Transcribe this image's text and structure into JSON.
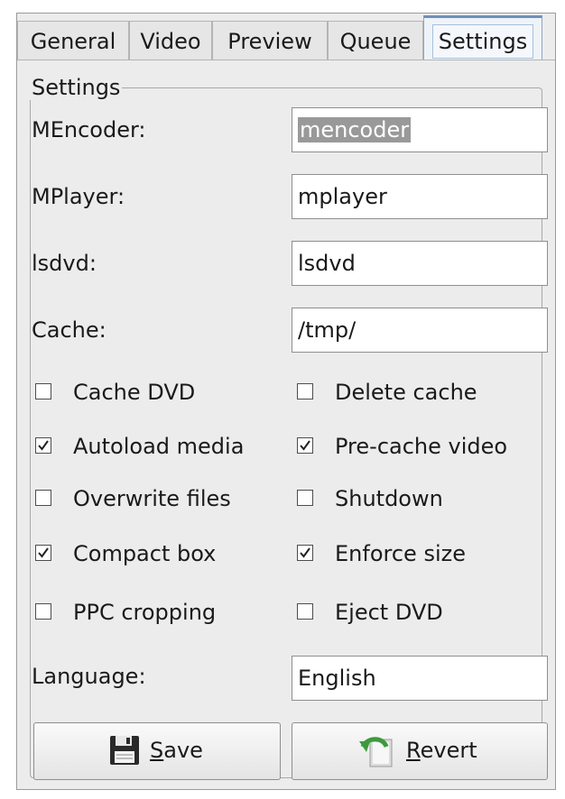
{
  "tabs": [
    {
      "label": "General"
    },
    {
      "label": "Video"
    },
    {
      "label": "Preview"
    },
    {
      "label": "Queue"
    },
    {
      "label": "Settings",
      "active": true
    }
  ],
  "settings": {
    "group_title": "Settings",
    "fields": [
      {
        "label": "MEncoder:",
        "value": "mencoder",
        "selected": true
      },
      {
        "label": "MPlayer:",
        "value": "mplayer"
      },
      {
        "label": "lsdvd:",
        "value": "lsdvd"
      },
      {
        "label": "Cache:",
        "value": "/tmp/"
      }
    ],
    "checkboxes": [
      {
        "label": "Cache DVD",
        "checked": false
      },
      {
        "label": "Delete cache",
        "checked": false
      },
      {
        "label": "Autoload media",
        "checked": true
      },
      {
        "label": "Pre-cache video",
        "checked": true
      },
      {
        "label": "Overwrite files",
        "checked": false
      },
      {
        "label": "Shutdown",
        "checked": false
      },
      {
        "label": "Compact box",
        "checked": true
      },
      {
        "label": "Enforce size",
        "checked": true
      },
      {
        "label": "PPC cropping",
        "checked": false
      },
      {
        "label": "Eject DVD",
        "checked": false
      }
    ],
    "language": {
      "label": "Language:",
      "value": "English"
    }
  },
  "buttons": {
    "save": {
      "mnemonic": "S",
      "rest": "ave",
      "icon": "floppy-disk-icon"
    },
    "revert": {
      "mnemonic": "R",
      "rest": "evert",
      "icon": "revert-arrow-icon"
    }
  },
  "colors": {
    "active_tab_accent": "#6f8fb8",
    "selection": "#999999"
  }
}
